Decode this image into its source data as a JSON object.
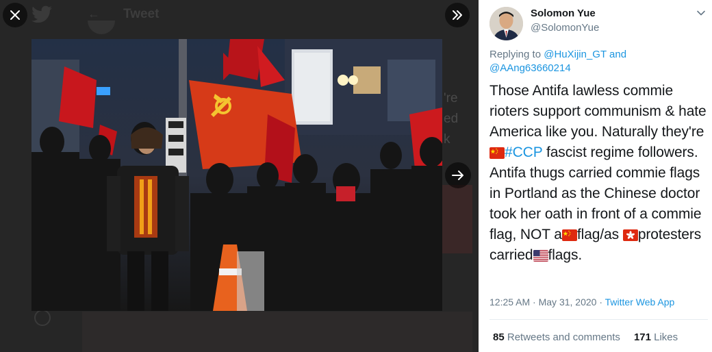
{
  "viewer": {
    "background_title": "Tweet",
    "background_side_fragments": [
      "'re",
      "ed",
      "k"
    ],
    "close_icon": "close-icon",
    "expand_icon": "expand-panel-icon",
    "next_icon": "arrow-right-icon"
  },
  "tweet": {
    "author_name": "Solomon Yue",
    "author_handle": "@SolomonYue",
    "replying_prefix": "Replying to ",
    "replying_user_1": "@HuXijin_GT",
    "replying_and": " and",
    "replying_user_2": "@AAng63660214",
    "text_part_1": "Those Antifa lawless commie rioters support communism & hate America like you. Naturally they're",
    "hashtag": "#CCP",
    "text_part_2": " fascist regime followers. Antifa thugs carried commie flags in Portland as the Chinese doctor took her oath in front of a commie flag, NOT a",
    "text_part_3": "flag/as ",
    "text_part_4": "protesters carried",
    "text_part_5": "flags.",
    "time": "12:25 AM",
    "separator": " · ",
    "date": "May 31, 2020",
    "separator2": " · ",
    "app": "Twitter Web App",
    "retweets_count": "85",
    "retweets_label": " Retweets and comments",
    "likes_count": "171",
    "likes_label": " Likes"
  },
  "colors": {
    "link": "#1b95e0",
    "text": "#14171a",
    "muted": "#657786",
    "viewer_bg": "#262626"
  }
}
